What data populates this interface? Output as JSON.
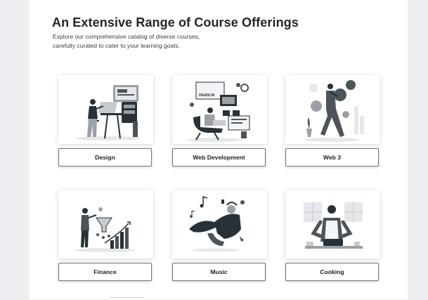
{
  "section": {
    "title": "An Extensive Range of Course Offerings",
    "subtitle_line1": "Explore our comprehensive catalog of diverse courses,",
    "subtitle_line2": "carefully curated to cater to your learning goals."
  },
  "courses": [
    {
      "label": "Design",
      "illustration": "designer-at-drafting-table"
    },
    {
      "label": "Web Development",
      "illustration": "developer-in-chair-with-laptop"
    },
    {
      "label": "Web 3",
      "illustration": "person-carrying-coins"
    },
    {
      "label": "Finance",
      "illustration": "presenter-with-growth-chart"
    },
    {
      "label": "Music",
      "illustration": "person-with-headphones-and-notes"
    },
    {
      "label": "Cooking",
      "illustration": "chef-with-cooking-pot"
    }
  ],
  "illustration_text": {
    "headline_tag": "HEADLIN"
  },
  "colors": {
    "background": "#eeeff2",
    "panel": "#ffffff",
    "title": "#22252a",
    "illustration_dark": "#263238",
    "illustration_gray": "#9aa0a6",
    "illustration_light": "#e6e7ea"
  }
}
